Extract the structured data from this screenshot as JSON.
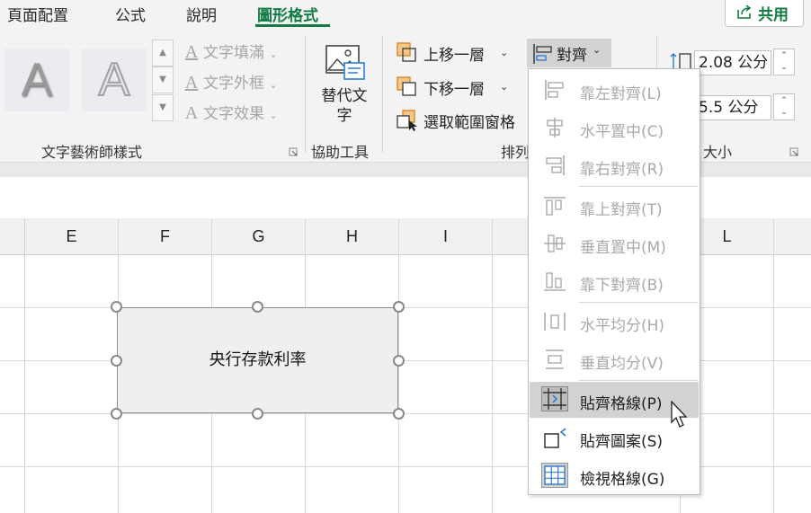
{
  "tabs": [
    {
      "label": "頁面配置",
      "active": false
    },
    {
      "label": "公式",
      "active": false
    },
    {
      "label": "說明",
      "active": false
    },
    {
      "label": "圖形格式",
      "active": true
    }
  ],
  "share_label": "共用",
  "wordart": {
    "samples": [
      "A",
      "A"
    ],
    "text_fill": "文字填滿",
    "text_outline": "文字外框",
    "text_effects": "文字效果",
    "group_label": "文字藝術師樣式"
  },
  "accessibility": {
    "alt_text": "替代文字",
    "group_label": "協助工具"
  },
  "arrange": {
    "bring_forward": "上移一層",
    "send_backward": "下移一層",
    "selection_pane": "選取範圍窗格",
    "align": "對齊",
    "group_label": "排列"
  },
  "size": {
    "height": "2.08 公分",
    "width": "5.5 公分",
    "group_label": "大小"
  },
  "columns": [
    "E",
    "F",
    "G",
    "H",
    "I",
    "L"
  ],
  "shape_text": "央行存款利率",
  "align_menu": [
    {
      "label": "靠左對齊(L)",
      "enabled": false,
      "icon": "align-left-icon"
    },
    {
      "label": "水平置中(C)",
      "enabled": false,
      "icon": "align-center-icon"
    },
    {
      "label": "靠右對齊(R)",
      "enabled": false,
      "icon": "align-right-icon"
    },
    {
      "label": "靠上對齊(T)",
      "enabled": false,
      "icon": "align-top-icon"
    },
    {
      "label": "垂直置中(M)",
      "enabled": false,
      "icon": "align-middle-icon"
    },
    {
      "label": "靠下對齊(B)",
      "enabled": false,
      "icon": "align-bottom-icon"
    },
    {
      "label": "水平均分(H)",
      "enabled": false,
      "icon": "distribute-horizontal-icon"
    },
    {
      "label": "垂直均分(V)",
      "enabled": false,
      "icon": "distribute-vertical-icon"
    },
    {
      "label": "貼齊格線(P)",
      "enabled": true,
      "icon": "snap-to-grid-icon"
    },
    {
      "label": "貼齊圖案(S)",
      "enabled": true,
      "icon": "snap-to-shape-icon"
    },
    {
      "label": "檢視格線(G)",
      "enabled": true,
      "icon": "view-gridlines-icon"
    }
  ],
  "colors": {
    "accent": "#107c41",
    "menu_highlight": "#d2d2d2",
    "disabled_text": "#a9a9a9"
  }
}
